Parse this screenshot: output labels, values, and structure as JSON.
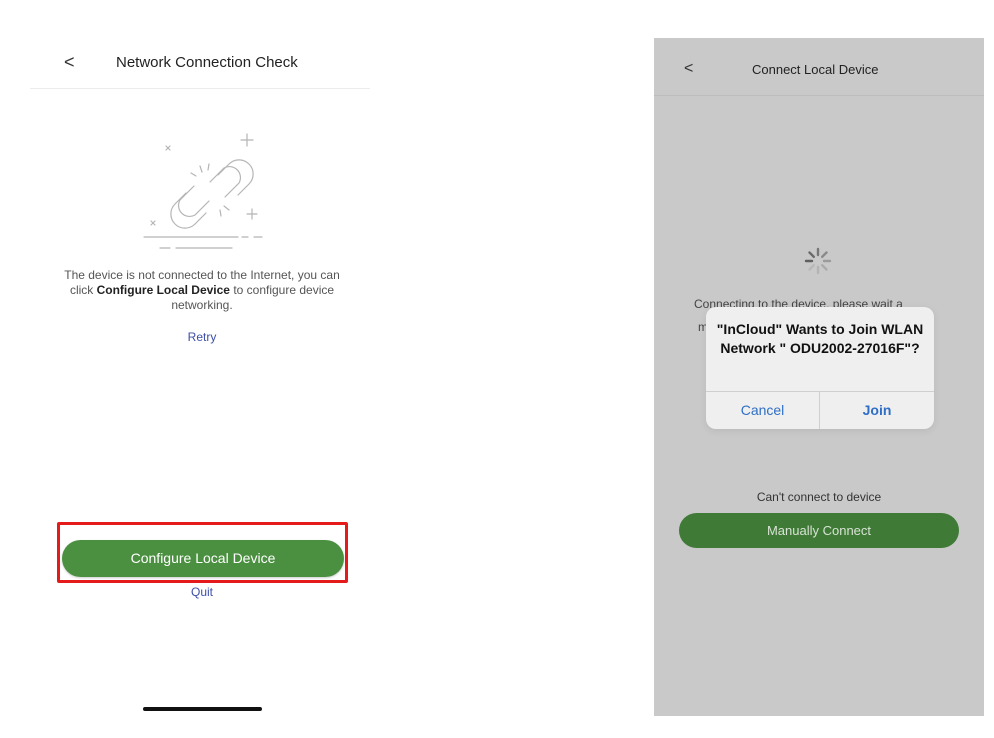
{
  "left_screen": {
    "nav": {
      "back_icon": "<",
      "title": "Network Connection Check"
    },
    "message": {
      "part1": "The device is not connected to the Internet, you can click ",
      "bold": "Configure Local Device",
      "part2": " to configure device networking."
    },
    "retry_label": "Retry",
    "configure_button_label": "Configure Local Device",
    "quit_label": "Quit",
    "highlight_color": "#e51b1b",
    "button_color": "#4b9040",
    "illustration_icon": "broken-link-icon"
  },
  "right_screen": {
    "nav": {
      "back_icon": "<",
      "title": "Connect Local Device"
    },
    "background_text_line1": "Connecting to the device, please wait a",
    "background_text_line2": "m",
    "alert": {
      "title": "\"InCloud\" Wants to Join WLAN Network \" ODU2002-27016F\"?",
      "cancel_label": "Cancel",
      "join_label": "Join"
    },
    "cant_connect_label": "Can't connect to device",
    "manual_button_label": "Manually Connect",
    "spinner_icon": "loading-spinner-icon",
    "overlay_color": "#c9c9c9"
  }
}
